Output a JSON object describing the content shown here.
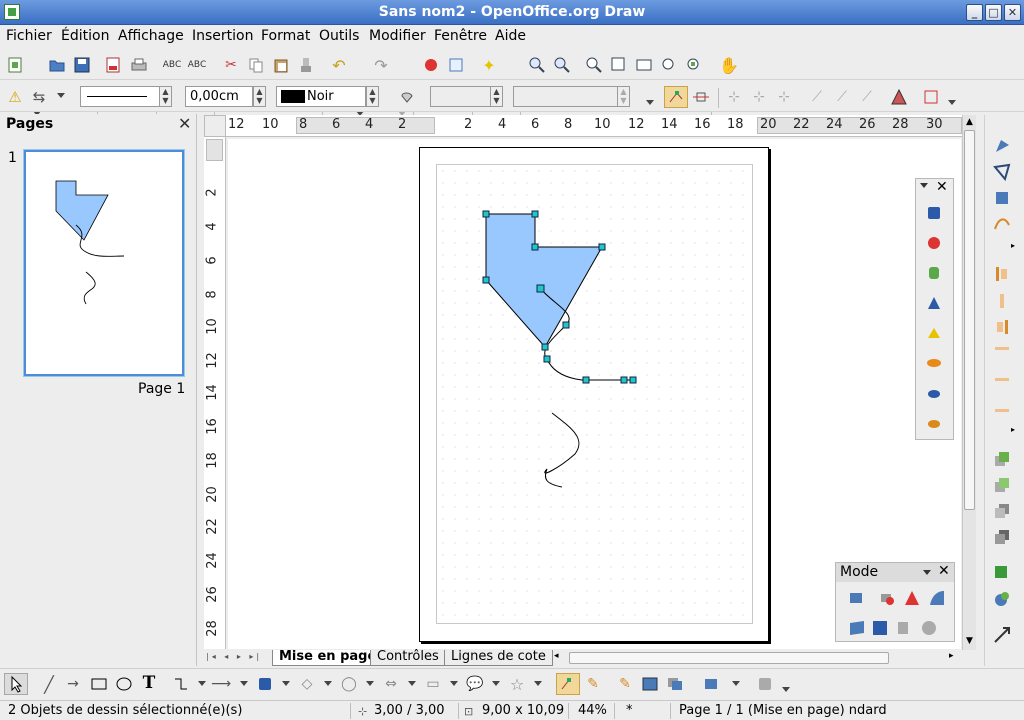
{
  "window": {
    "title": "Sans nom2 - OpenOffice.org Draw",
    "min": "_",
    "max": "□",
    "close": "✕"
  },
  "menu": [
    "Fichier",
    "Édition",
    "Affichage",
    "Insertion",
    "Format",
    "Outils",
    "Modifier",
    "Fenêtre",
    "Aide"
  ],
  "line_props": {
    "width": "0,00cm",
    "color_name": "Noir",
    "color": "#000000"
  },
  "pages_panel": {
    "title": "Pages",
    "close": "✕",
    "page_number": "1",
    "page_label": "Page 1"
  },
  "rulers": {
    "h": [
      "12",
      "10",
      "8",
      "6",
      "4",
      "2",
      "2",
      "4",
      "6",
      "8",
      "10",
      "12",
      "14",
      "16",
      "18",
      "20",
      "22",
      "24",
      "26",
      "28",
      "30"
    ],
    "v": [
      "2",
      "4",
      "6",
      "8",
      "10",
      "12",
      "14",
      "16",
      "18",
      "20",
      "22",
      "24",
      "26",
      "28"
    ]
  },
  "tabs": [
    "Mise en page",
    "Contrôles",
    "Lignes de cote"
  ],
  "mode_panel": {
    "title": "Mode",
    "close": "✕"
  },
  "palette": {
    "close": "✕"
  },
  "status": {
    "selection": "2 Objets de dessin sélectionné(e)(s)",
    "position": "3,00 / 3,00",
    "size": "9,00 x 10,09",
    "zoom": "44%",
    "modified": "*",
    "page_info": "Page 1 / 1 (Mise en page) ndard"
  },
  "colors": {
    "shape_fill": "#99c8ff",
    "handle": "#1fc8c8",
    "title_bar": "#3b6fc4"
  }
}
